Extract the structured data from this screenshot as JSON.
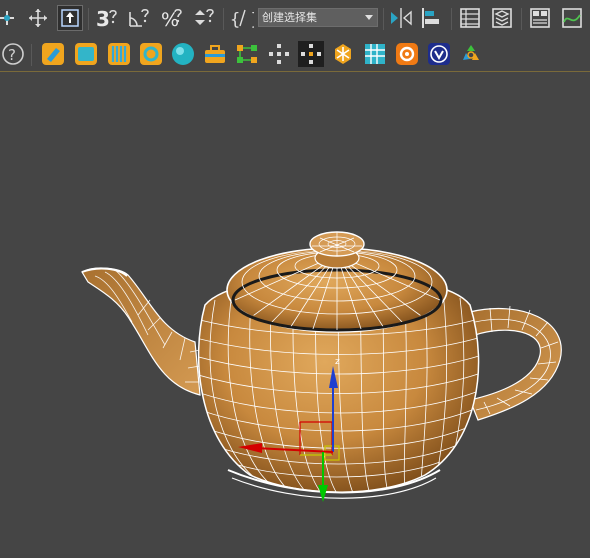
{
  "main_toolbar": {
    "named_selection_set": "创建选择集",
    "buttons": [
      {
        "id": "select-link",
        "icon": "link-icon"
      },
      {
        "id": "select-move",
        "icon": "move-icon"
      },
      {
        "id": "select-object",
        "icon": "select-arrow-icon"
      },
      {
        "id": "snap-3d",
        "label": "3"
      },
      {
        "id": "angle-snap",
        "icon": "angle-snap-icon"
      },
      {
        "id": "percent-snap",
        "label": "%"
      },
      {
        "id": "spinner-snap",
        "icon": "spinner-snap-icon"
      },
      {
        "id": "edit-named-sets",
        "icon": "braces-icon"
      },
      {
        "id": "mirror",
        "icon": "mirror-icon"
      },
      {
        "id": "align",
        "icon": "align-icon"
      },
      {
        "id": "scene-explorer",
        "icon": "list-icon"
      },
      {
        "id": "layer-explorer",
        "icon": "layers-icon"
      },
      {
        "id": "ribbon",
        "icon": "ribbon-icon"
      },
      {
        "id": "curve-editor",
        "icon": "curve-editor-icon"
      }
    ]
  },
  "plugin_toolbar": {
    "icons": [
      "help-icon",
      "eraser-icon",
      "fill-icon",
      "palette-icon",
      "gear-icon",
      "sphere-icon",
      "toolbox-icon",
      "hierarchy-icon",
      "scatter-icon",
      "scatter-selected-icon",
      "snowflake-icon",
      "grid-icon",
      "render-icon",
      "vray-icon",
      "recycle-icon"
    ]
  },
  "viewport": {
    "object": "teapot",
    "colors": {
      "mesh": "#c98a3f",
      "wire": "#ffffff",
      "gizmo_x": "#d40000",
      "gizmo_y": "#00c800",
      "gizmo_z": "#1e3fd0"
    }
  }
}
